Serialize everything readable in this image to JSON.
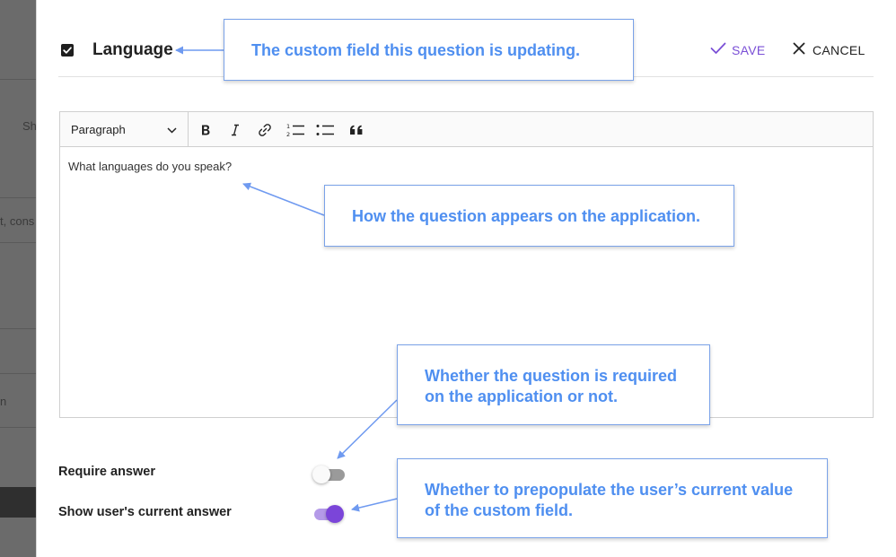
{
  "background": {
    "fragments": [
      "Sh",
      "t, cons",
      "n"
    ]
  },
  "header": {
    "title": "Language",
    "save_label": "SAVE",
    "cancel_label": "CANCEL"
  },
  "editor": {
    "format_value": "Paragraph",
    "tools": [
      "bold-icon",
      "italic-icon",
      "link-icon",
      "numbered-list-icon",
      "bulleted-list-icon",
      "quote-icon"
    ],
    "content": "What languages do you speak?"
  },
  "toggles": [
    {
      "label": "Require answer",
      "state": false
    },
    {
      "label": "Show user's current answer",
      "state": true
    }
  ],
  "callouts": {
    "field": "The custom field this question is updating.",
    "question": "How the question appears on the application.",
    "required": "Whether the question is required on the application or not.",
    "prepopulate": "Whether to prepopulate the user’s current value of the custom field."
  },
  "colors": {
    "accent": "#7a4fd6",
    "callout_text": "#4f8ff0",
    "callout_border": "#7aa2e8"
  }
}
